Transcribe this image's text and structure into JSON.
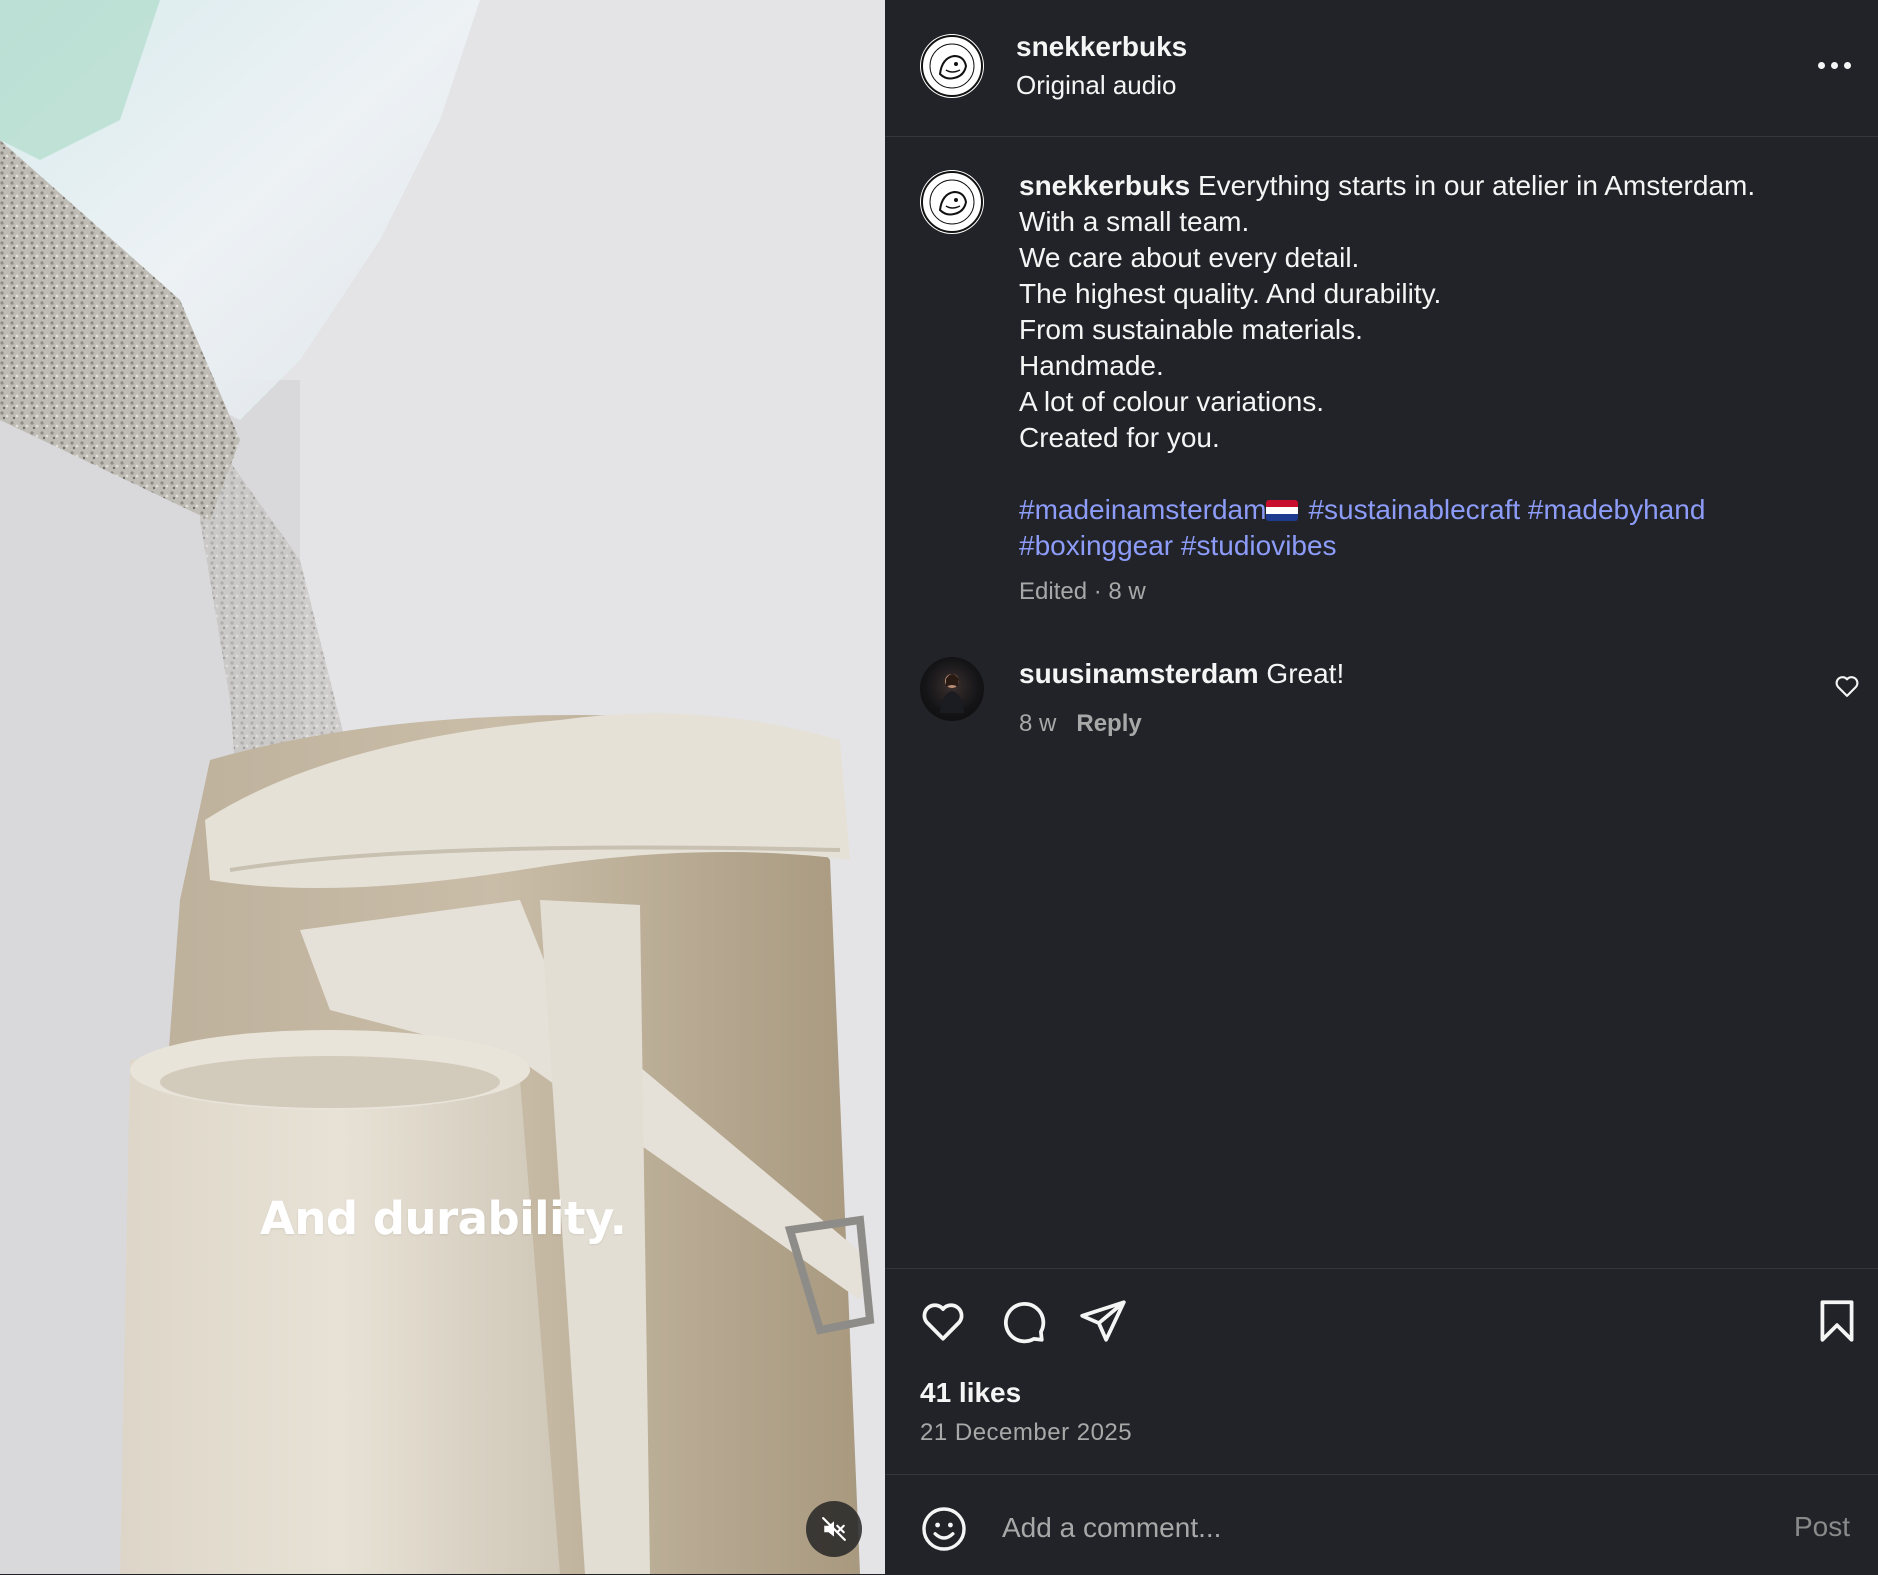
{
  "media": {
    "overlay_caption": "And durability.",
    "mute_icon": "speaker-muted-icon"
  },
  "header": {
    "username": "snekkerbuks",
    "audio_label": "Original audio",
    "more_icon": "more-options-icon"
  },
  "caption": {
    "username": "snekkerbuks",
    "lines": [
      "Everything starts in our atelier in Amsterdam.",
      "With a small team.",
      "We care about every detail.",
      "The highest quality. And durability.",
      "From sustainable materials.",
      "Handmade.",
      "A lot of colour variations.",
      "Created for you."
    ],
    "hashtags": [
      "#madeinamsterdam",
      "#sustainablecraft",
      "#madebyhand",
      "#boxinggear",
      "#studiovibes"
    ],
    "meta": "Edited · 8 w"
  },
  "comments": [
    {
      "username": "suusinamsterdam",
      "text": "Great!",
      "time": "8 w",
      "reply_label": "Reply"
    }
  ],
  "actions": {
    "likes": "41 likes",
    "date": "21 December 2025"
  },
  "comment_box": {
    "placeholder": "Add a comment...",
    "post_label": "Post"
  },
  "colors": {
    "panel_bg": "#212328",
    "hashtag": "#8c9cf8",
    "muted_text": "#a8a8a8"
  }
}
